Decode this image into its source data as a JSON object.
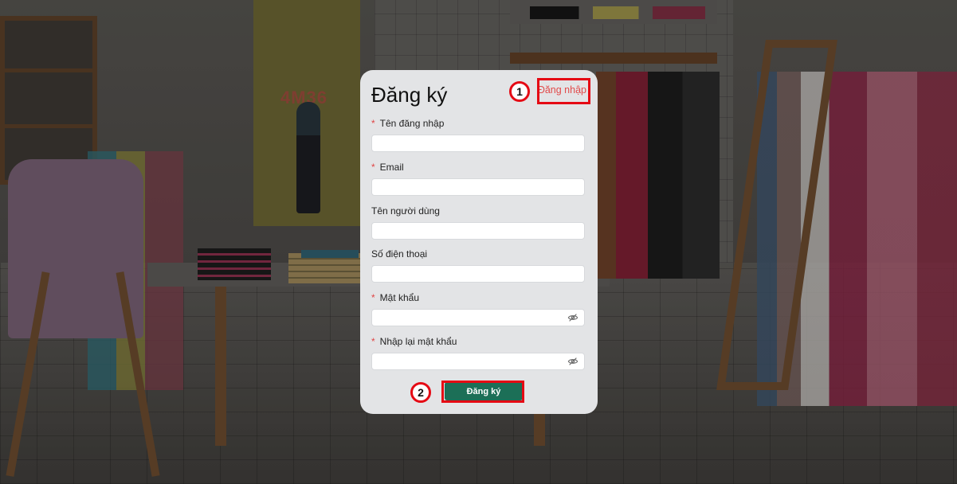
{
  "form": {
    "title": "Đăng ký",
    "login_link": "Đăng nhập",
    "submit_label": "Đăng ký",
    "fields": [
      {
        "label": "Tên đăng nhập",
        "required": "*",
        "value": ""
      },
      {
        "label": "Email",
        "required": "*",
        "value": ""
      },
      {
        "label": "Tên người dùng",
        "value": ""
      },
      {
        "label": "Số điện thoại",
        "value": ""
      },
      {
        "label": "Mật khẩu",
        "required": "*",
        "value": "",
        "icon": "eye-slash-icon"
      },
      {
        "label": "Nhập lại mật khẩu",
        "required": "*",
        "value": "",
        "icon": "eye-slash-icon"
      }
    ]
  },
  "background": {
    "poster_text": "4M36"
  },
  "annotations": {
    "marker_1": "1",
    "marker_2": "2",
    "highlight_color": "#e50914"
  },
  "colors": {
    "submit_bg": "#1c6f57",
    "link": "#e24a4a",
    "card_bg": "#e3e4e6"
  }
}
